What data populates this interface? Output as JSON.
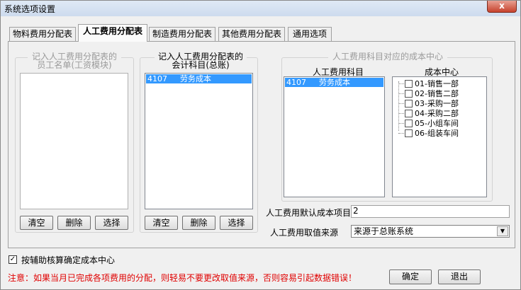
{
  "window": {
    "title": "系统选项设置",
    "close_glyph": "x"
  },
  "tabs": [
    {
      "label": "物料费用分配表"
    },
    {
      "label": "人工费用分配表"
    },
    {
      "label": "制造费用分配表"
    },
    {
      "label": "其他费用分配表"
    },
    {
      "label": "通用选项"
    }
  ],
  "employee_group": {
    "legend_line1": "记入人工费用分配表的",
    "legend_line2": "员工名单(工资模块)",
    "clear_label": "清空",
    "delete_label": "删除",
    "select_label": "选择"
  },
  "account_group": {
    "legend_line1": "记入人工费用分配表的",
    "legend_line2": "会计科目(总账)",
    "items": [
      {
        "code": "4107",
        "name": "劳务成本"
      }
    ],
    "clear_label": "清空",
    "delete_label": "删除",
    "select_label": "选择"
  },
  "cost_center_group": {
    "legend": "人工费用科目对应的成本中心",
    "subject_header": "人工费用科目",
    "center_header": "成本中心",
    "subjects": [
      {
        "code": "4107",
        "name": "劳务成本"
      }
    ],
    "centers": [
      {
        "label": "01-销售一部",
        "checked": false
      },
      {
        "label": "02-销售二部",
        "checked": false
      },
      {
        "label": "03-采购一部",
        "checked": false
      },
      {
        "label": "04-采购二部",
        "checked": false
      },
      {
        "label": "05-小组车间",
        "checked": false
      },
      {
        "label": "06-组装车间",
        "checked": false
      }
    ]
  },
  "default_cost_item": {
    "label": "人工费用默认成本项目",
    "value": "2"
  },
  "value_source": {
    "label": "人工费用取值来源",
    "value": "来源于总账系统",
    "arrow": "▼"
  },
  "aux_option": {
    "label": "按辅助核算确定成本中心",
    "checked": true,
    "mark": "✓"
  },
  "warning_text": "注意：如果当月已完成各项费用的分配，则轻易不要更改取值来源，否则容易引起数据错误！",
  "footer": {
    "ok_label": "确定",
    "exit_label": "退出"
  }
}
